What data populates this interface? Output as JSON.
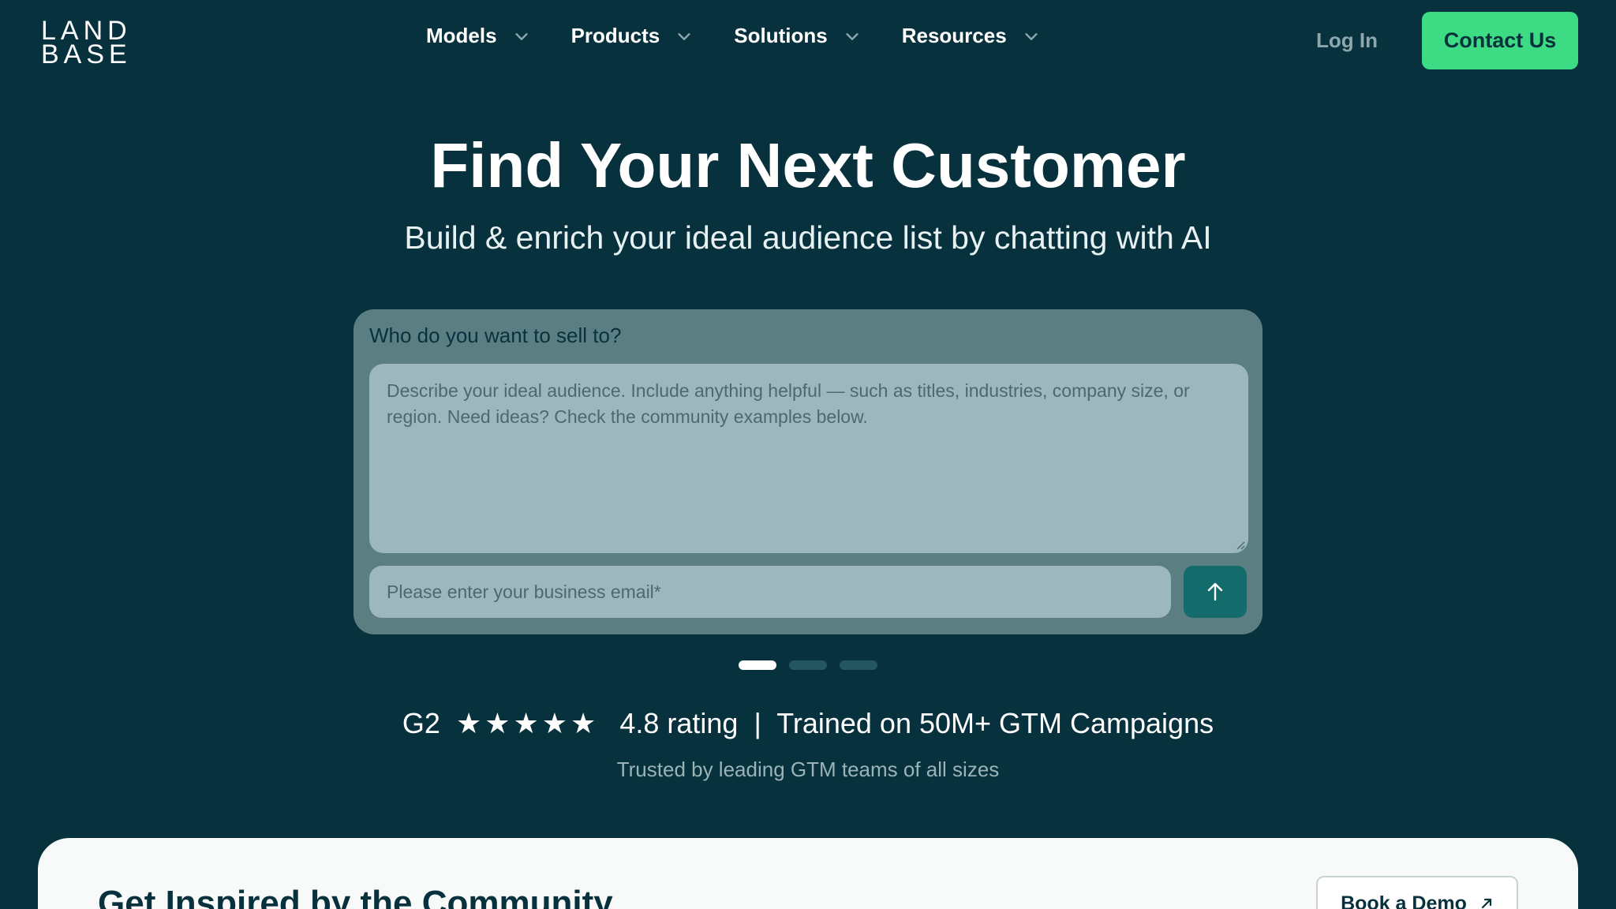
{
  "nav": {
    "logo_line1": "LAND",
    "logo_line2": "BASE",
    "items": [
      {
        "label": "Models"
      },
      {
        "label": "Products"
      },
      {
        "label": "Solutions"
      },
      {
        "label": "Resources"
      }
    ],
    "login_label": "Log In",
    "contact_label": "Contact Us"
  },
  "hero": {
    "title": "Find Your Next Customer",
    "subtitle": "Build & enrich your ideal audience list by chatting with AI"
  },
  "form": {
    "label": "Who do you want to sell to?",
    "textarea_placeholder": "Describe your ideal audience. Include anything helpful — such as titles, industries, company size, or region. Need ideas? Check the community examples below.",
    "email_placeholder": "Please enter your business email*",
    "send_icon": "arrow-up-icon"
  },
  "carousel": {
    "dot_count": 3,
    "active_index": 0
  },
  "rating": {
    "source": "G2",
    "stars": "★★★★★",
    "value": "4.8 rating",
    "separator": "|",
    "tagline": "Trained on 50M+ GTM Campaigns",
    "trusted": "Trusted by leading GTM teams of all sizes"
  },
  "community": {
    "title": "Get Inspired by the Community",
    "demo_label": "Book a Demo"
  },
  "colors": {
    "background": "#07313d",
    "accent": "#3ddc84",
    "card": "#5a7e82",
    "input": "#9db8bc",
    "send_button": "#136b6c"
  }
}
